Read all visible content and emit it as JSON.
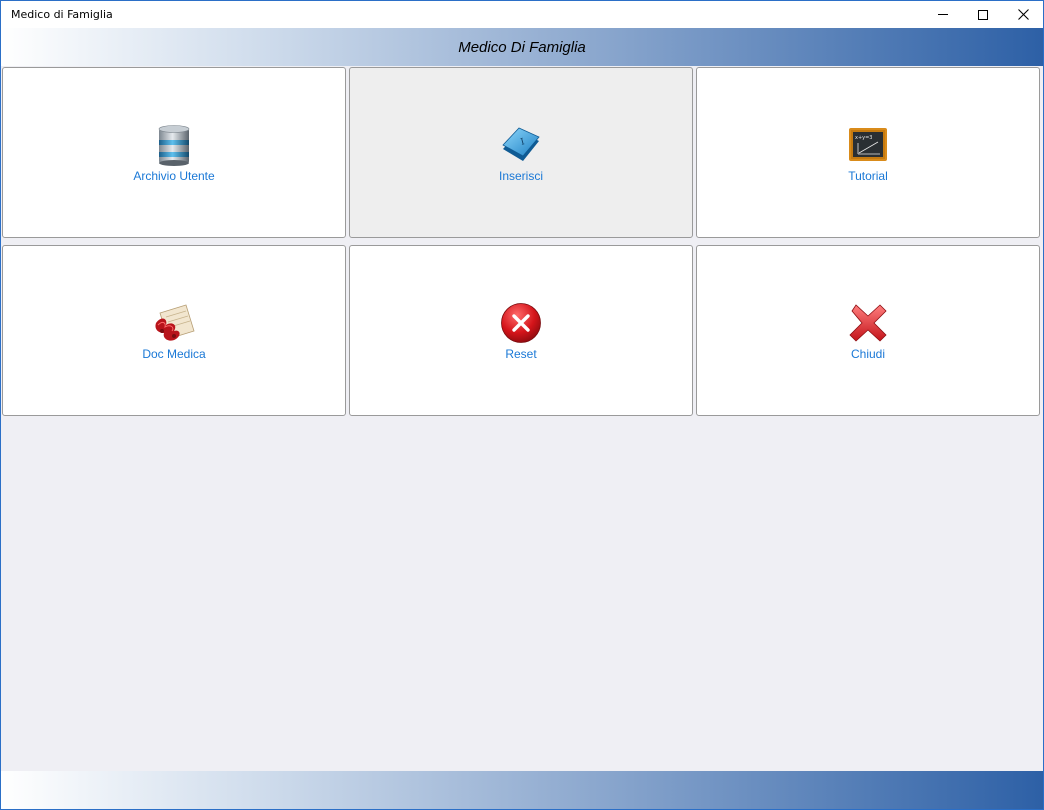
{
  "window": {
    "title": "Medico di Famiglia",
    "controls": {
      "minimize": "minimize-icon",
      "maximize": "maximize-icon",
      "close": "close-icon"
    }
  },
  "header": {
    "title": "Medico Di Famiglia"
  },
  "tiles": [
    {
      "label": "Archivio Utente",
      "icon": "database-icon"
    },
    {
      "label": "Inserisci",
      "icon": "keyboard-key-icon"
    },
    {
      "label": "Tutorial",
      "icon": "chalkboard-icon"
    },
    {
      "label": "Doc Medica",
      "icon": "medical-document-icon"
    },
    {
      "label": "Reset",
      "icon": "reset-icon"
    },
    {
      "label": "Chiudi",
      "icon": "close-x-icon"
    }
  ],
  "colors": {
    "label_text": "#1a78d6",
    "header_gradient_end": "#2d60a6",
    "background": "#efeff4"
  }
}
